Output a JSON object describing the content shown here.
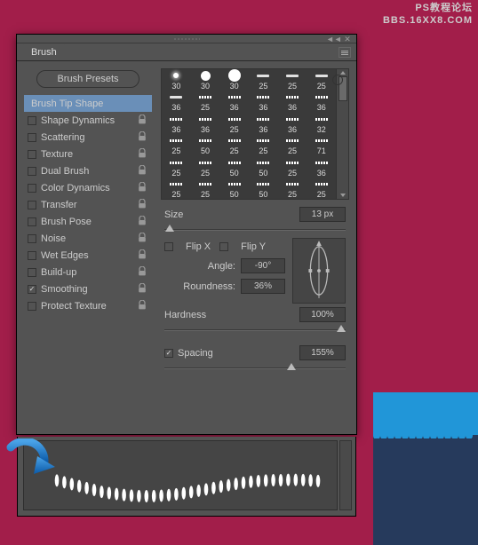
{
  "watermark": {
    "line1": "PS教程论坛",
    "line2": "BBS.16XX8.COM"
  },
  "panel": {
    "tab": "Brush",
    "presets_button": "Brush Presets",
    "sidebar_items": [
      {
        "label": "Brush Tip Shape",
        "has_checkbox": false,
        "checked": false,
        "lock": false,
        "active": true
      },
      {
        "label": "Shape Dynamics",
        "has_checkbox": true,
        "checked": false,
        "lock": true
      },
      {
        "label": "Scattering",
        "has_checkbox": true,
        "checked": false,
        "lock": true
      },
      {
        "label": "Texture",
        "has_checkbox": true,
        "checked": false,
        "lock": true
      },
      {
        "label": "Dual Brush",
        "has_checkbox": true,
        "checked": false,
        "lock": true
      },
      {
        "label": "Color Dynamics",
        "has_checkbox": true,
        "checked": false,
        "lock": true
      },
      {
        "label": "Transfer",
        "has_checkbox": true,
        "checked": false,
        "lock": true
      },
      {
        "label": "Brush Pose",
        "has_checkbox": true,
        "checked": false,
        "lock": true
      },
      {
        "label": "Noise",
        "has_checkbox": true,
        "checked": false,
        "lock": true
      },
      {
        "label": "Wet Edges",
        "has_checkbox": true,
        "checked": false,
        "lock": true
      },
      {
        "label": "Build-up",
        "has_checkbox": true,
        "checked": false,
        "lock": true
      },
      {
        "label": "Smoothing",
        "has_checkbox": true,
        "checked": true,
        "lock": true
      },
      {
        "label": "Protect Texture",
        "has_checkbox": true,
        "checked": false,
        "lock": true
      }
    ],
    "thumbs": [
      [
        "30",
        "30",
        "30",
        "25",
        "25",
        "25"
      ],
      [
        "36",
        "25",
        "36",
        "36",
        "36",
        "36"
      ],
      [
        "36",
        "36",
        "25",
        "36",
        "36",
        "32"
      ],
      [
        "25",
        "50",
        "25",
        "25",
        "25",
        "71"
      ],
      [
        "25",
        "25",
        "50",
        "50",
        "25",
        "36"
      ],
      [
        "25",
        "25",
        "50",
        "50",
        "25",
        "25"
      ]
    ],
    "size_label": "Size",
    "size_value": "13 px",
    "flipx": "Flip X",
    "flipy": "Flip Y",
    "angle_label": "Angle:",
    "angle_value": "-90°",
    "roundness_label": "Roundness:",
    "roundness_value": "36%",
    "hardness_label": "Hardness",
    "hardness_value": "100%",
    "spacing_label": "Spacing",
    "spacing_value": "155%"
  }
}
